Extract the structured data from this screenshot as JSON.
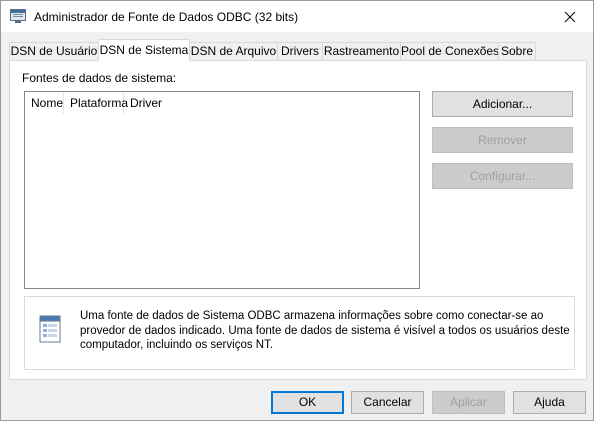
{
  "window": {
    "title": "Administrador de Fonte de Dados ODBC (32 bits)",
    "close_glyph": "✕"
  },
  "tabs": [
    {
      "label": "DSN de Usuário",
      "active": false
    },
    {
      "label": "DSN de Sistema",
      "active": true
    },
    {
      "label": "DSN de Arquivo",
      "active": false
    },
    {
      "label": "Drivers",
      "active": false
    },
    {
      "label": "Rastreamento",
      "active": false
    },
    {
      "label": "Pool de Conexões",
      "active": false
    },
    {
      "label": "Sobre",
      "active": false
    }
  ],
  "panel": {
    "section_label": "Fontes de dados de sistema:",
    "columns": [
      "Nome",
      "Plataforma",
      "Driver"
    ],
    "rows": [],
    "buttons": {
      "add": "Adicionar...",
      "remove": "Remover",
      "configure": "Configurar..."
    },
    "info_text": "Uma fonte de dados de Sistema ODBC armazena informações sobre como conectar-se ao provedor de dados indicado. Uma fonte de dados de sistema é visível a todos os usuários deste computador, incluindo os serviços NT."
  },
  "footer": {
    "ok": "OK",
    "cancel": "Cancelar",
    "apply": "Aplicar",
    "help": "Ajuda"
  },
  "icons": {
    "title_icon": "odbc-app-icon",
    "info_icon": "data-source-icon",
    "close_icon": "close-icon"
  },
  "colors": {
    "default_button_border": "#0078d7",
    "disabled_text": "#a0a0a0"
  }
}
